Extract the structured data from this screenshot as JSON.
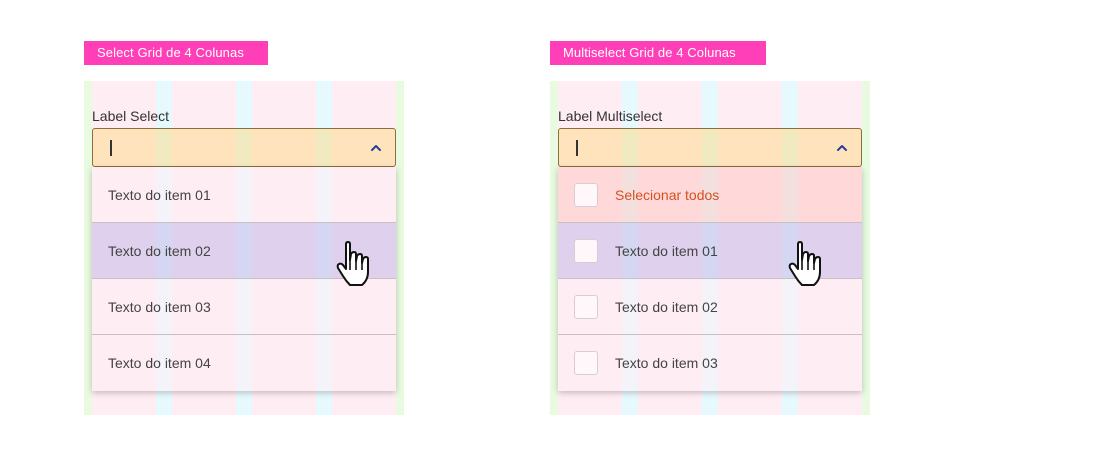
{
  "select_demo": {
    "tag": "Select Grid de 4 Colunas",
    "label": "Label Select",
    "input_value": "",
    "items": [
      {
        "text": "Texto do item 01"
      },
      {
        "text": "Texto do item 02"
      },
      {
        "text": "Texto do item 03"
      },
      {
        "text": "Texto do item 04"
      }
    ],
    "hovered_item": "Texto do item 02"
  },
  "multiselect_demo": {
    "tag": "Multiselect Grid de 4 Colunas",
    "label": "Label Multiselect",
    "input_value": "",
    "select_all": "Selecionar todos",
    "items": [
      {
        "text": "Texto do item 01",
        "checked": false
      },
      {
        "text": "Texto do item 02",
        "checked": false
      },
      {
        "text": "Texto do item 03",
        "checked": false
      }
    ],
    "hovered_item": "Texto do item 01"
  },
  "icons": {
    "dropdown_toggle": "chevron-up-icon",
    "pointer": "hand-pointer-icon",
    "checkbox": "checkbox-icon"
  },
  "colors": {
    "tag_background": "#ff3fb8",
    "column": "#ffedf4",
    "gutter": "#e6fafe",
    "margin": "#e8fae0",
    "field_background": "#fbe3b4",
    "field_border": "#8b6e3a",
    "chevron": "#2a3f9a",
    "hover_row": "#ddd6ee",
    "select_all_text": "#d4521f"
  }
}
